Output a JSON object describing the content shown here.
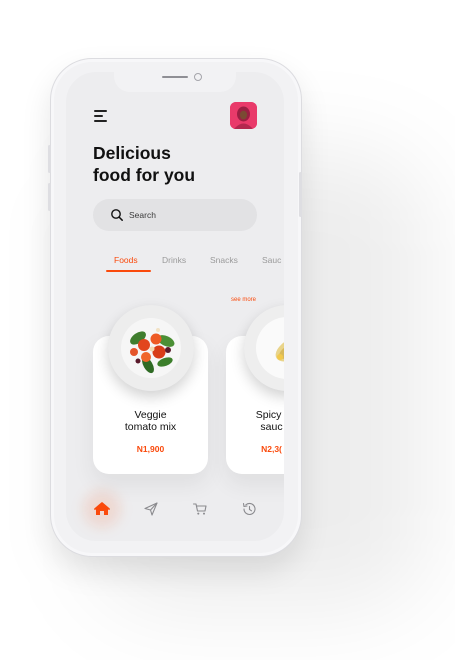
{
  "header": {
    "title_line1": "Delicious",
    "title_line2": "food for you"
  },
  "search": {
    "placeholder": "Search",
    "icon": "search-icon"
  },
  "tabs": [
    {
      "label": "Foods",
      "active": true
    },
    {
      "label": "Drinks",
      "active": false
    },
    {
      "label": "Snacks",
      "active": false
    },
    {
      "label": "Sauc",
      "active": false
    }
  ],
  "see_more": "see more",
  "products": [
    {
      "name_line1": "Veggie",
      "name_line2": "tomato mix",
      "price": "N1,900"
    },
    {
      "name_line1": "Spicy f",
      "name_line2": "sauc",
      "price": "N2,3("
    }
  ],
  "bottom_nav": [
    {
      "icon": "home-icon",
      "active": true
    },
    {
      "icon": "send-icon",
      "active": false
    },
    {
      "icon": "cart-icon",
      "active": false
    },
    {
      "icon": "history-icon",
      "active": false
    }
  ],
  "colors": {
    "accent": "#fa4a0c",
    "screen_bg": "#ededef",
    "card_bg": "#ffffff",
    "text_dark": "#111111",
    "text_muted": "#9a9a9a",
    "avatar_bg": "#e93a6a"
  }
}
